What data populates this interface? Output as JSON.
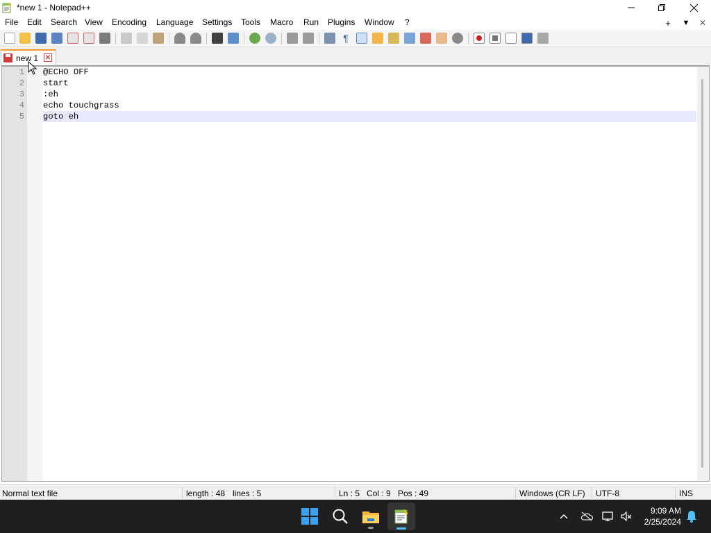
{
  "window": {
    "title": "*new 1 - Notepad++"
  },
  "menu": {
    "items": [
      "File",
      "Edit",
      "Search",
      "View",
      "Encoding",
      "Language",
      "Settings",
      "Tools",
      "Macro",
      "Run",
      "Plugins",
      "Window",
      "?"
    ],
    "right": [
      "+",
      "▼",
      "✕"
    ]
  },
  "toolbar": {
    "icons": [
      "new-file",
      "open-file",
      "save",
      "save-all",
      "close",
      "close-all",
      "print",
      "cut",
      "copy",
      "paste",
      "undo",
      "redo",
      "find",
      "replace",
      "zoom-in",
      "zoom-out",
      "sync-vertical",
      "sync-horizontal",
      "word-wrap",
      "show-all-characters",
      "indent-guide",
      "udl",
      "doc-map",
      "doc-list",
      "function-list",
      "folder-as-workspace",
      "monitoring",
      "record-macro",
      "stop-macro",
      "play-macro",
      "run-macro-multiple",
      "save-macro"
    ]
  },
  "tabs": [
    {
      "label": "new 1",
      "modified": true
    }
  ],
  "editor": {
    "lines": [
      {
        "number": "1",
        "text": "@ECHO OFF"
      },
      {
        "number": "2",
        "text": "start"
      },
      {
        "number": "3",
        "text": ":eh"
      },
      {
        "number": "4",
        "text": "echo touchgrass"
      },
      {
        "number": "5",
        "text": "goto eh"
      }
    ],
    "current_line": 5
  },
  "status": {
    "filetype": "Normal text file",
    "length": "length : 48",
    "lines": "lines : 5",
    "ln": "Ln : 5",
    "col": "Col : 9",
    "pos": "Pos : 49",
    "eol": "Windows (CR LF)",
    "encoding": "UTF-8",
    "mode": "INS"
  },
  "taskbar": {
    "apps": [
      "start-icon",
      "search-icon",
      "file-explorer-icon",
      "notepad-plus-plus-icon"
    ],
    "time": "9:09 AM",
    "date": "2/25/2024"
  },
  "colors": {
    "accent": "#fa9a2c",
    "current_line": "#e8e8ff",
    "taskbar": "#1f1f1f",
    "tab_modified": "#d43c3c"
  }
}
